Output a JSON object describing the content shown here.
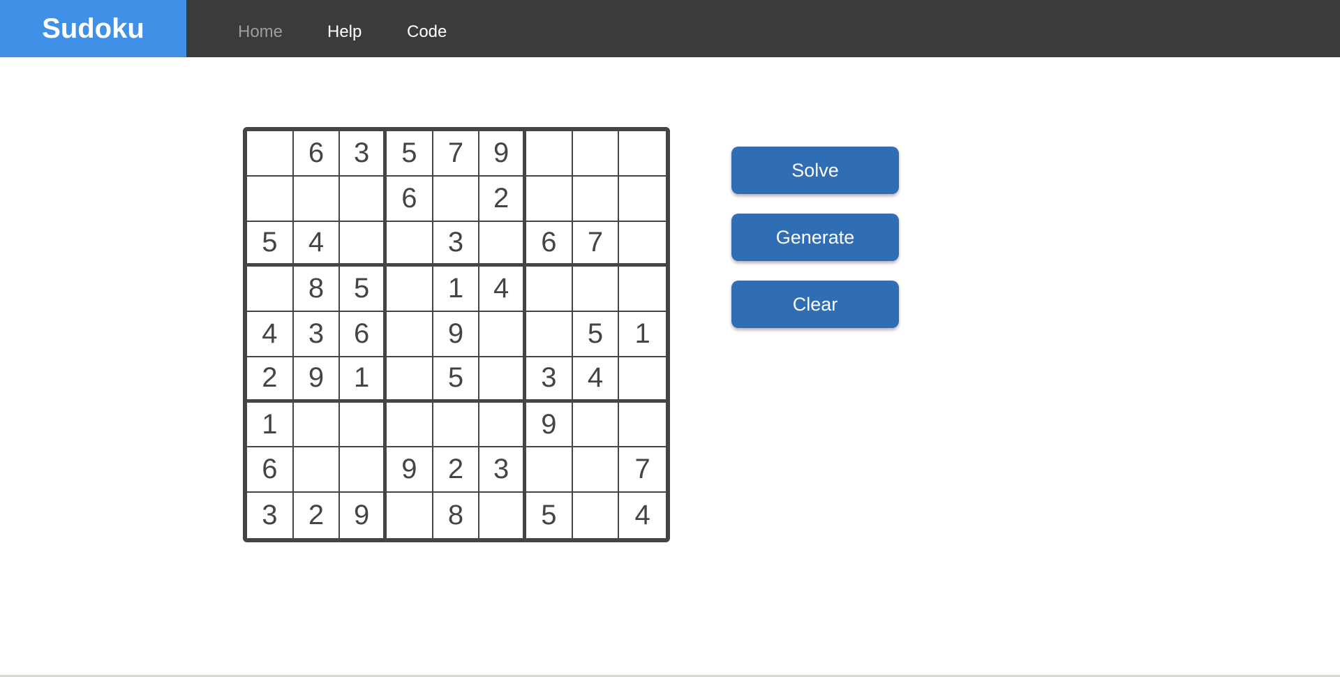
{
  "header": {
    "brand": "Sudoku",
    "brand_color": "#4090e8",
    "nav": [
      {
        "label": "Home",
        "active": true
      },
      {
        "label": "Help",
        "active": false
      },
      {
        "label": "Code",
        "active": false
      }
    ]
  },
  "board": {
    "rows": [
      [
        "",
        "6",
        "3",
        "5",
        "7",
        "9",
        "",
        "",
        ""
      ],
      [
        "",
        "",
        "",
        "6",
        "",
        "2",
        "",
        "",
        ""
      ],
      [
        "5",
        "4",
        "",
        "",
        "3",
        "",
        "6",
        "7",
        ""
      ],
      [
        "",
        "8",
        "5",
        "",
        "1",
        "4",
        "",
        "",
        ""
      ],
      [
        "4",
        "3",
        "6",
        "",
        "9",
        "",
        "",
        "5",
        "1"
      ],
      [
        "2",
        "9",
        "1",
        "",
        "5",
        "",
        "3",
        "4",
        ""
      ],
      [
        "1",
        "",
        "",
        "",
        "",
        "",
        "9",
        "",
        ""
      ],
      [
        "6",
        "",
        "",
        "9",
        "2",
        "3",
        "",
        "",
        "7"
      ],
      [
        "3",
        "2",
        "9",
        "",
        "8",
        "",
        "5",
        "",
        "4"
      ]
    ]
  },
  "actions": {
    "solve_label": "Solve",
    "generate_label": "Generate",
    "clear_label": "Clear",
    "button_color": "#2f6db5"
  }
}
